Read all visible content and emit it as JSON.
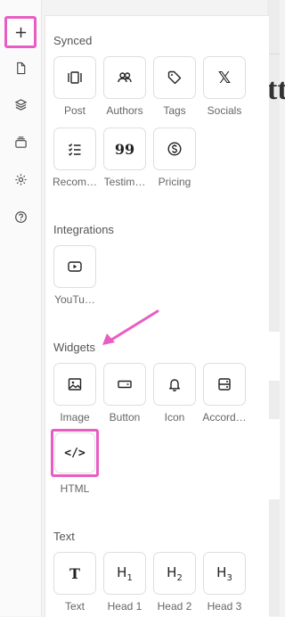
{
  "rail": {
    "icons": [
      "plus-icon",
      "page-icon",
      "layers-icon",
      "stack-icon",
      "settings-icon",
      "help-icon"
    ]
  },
  "sections": {
    "synced": {
      "title": "Synced",
      "items": [
        "Post",
        "Authors",
        "Tags",
        "Socials",
        "Recom…",
        "Testim…",
        "Pricing"
      ]
    },
    "integrations": {
      "title": "Integrations",
      "items": [
        "YouTu…"
      ]
    },
    "widgets": {
      "title": "Widgets",
      "items": [
        "Image",
        "Button",
        "Icon",
        "Accord…",
        "HTML"
      ]
    },
    "text": {
      "title": "Text",
      "items": [
        "Text",
        "Head 1",
        "Head 2",
        "Head 3"
      ]
    }
  },
  "glyphs": {
    "x": "𝕏",
    "quotes": "99",
    "text": "T",
    "h": "H",
    "h1": "1",
    "h2": "2",
    "h3": "3",
    "html": "</>",
    "dollar": "$"
  },
  "canvas": {
    "heading_fragment": "tt"
  },
  "colors": {
    "highlight": "#e85dc3",
    "accent": "#e85dc3"
  }
}
